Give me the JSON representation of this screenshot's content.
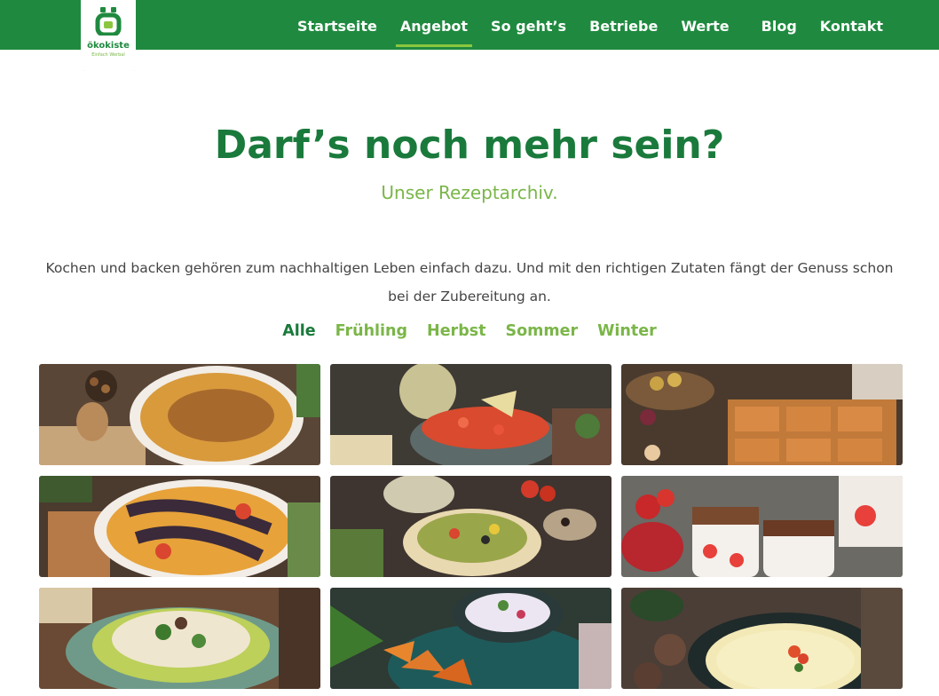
{
  "header": {
    "logo": {
      "brand": "ökokiste",
      "tagline": "Einfach Werbal"
    },
    "nav": [
      {
        "label": "Startseite",
        "active": false
      },
      {
        "label": "Angebot",
        "active": true
      },
      {
        "label": "So geht’s",
        "active": false
      },
      {
        "label": "Betriebe",
        "active": false
      },
      {
        "label": "Werte",
        "active": false
      },
      {
        "label": "Blog",
        "active": false
      },
      {
        "label": "Kontakt",
        "active": false
      }
    ]
  },
  "main": {
    "title": "Darf’s noch mehr sein?",
    "subtitle": "Unser Rezeptarchiv.",
    "intro": "Kochen und backen gehören zum nachhaltigen Leben einfach dazu. Und mit den richtigen Zutaten fängt der Genuss schon bei der Zubereitung an.",
    "filters": [
      {
        "label": "Alle",
        "active": true
      },
      {
        "label": "Frühling",
        "active": false
      },
      {
        "label": "Herbst",
        "active": false
      },
      {
        "label": "Sommer",
        "active": false
      },
      {
        "label": "Winter",
        "active": false
      }
    ]
  },
  "colors": {
    "header_green": "#1f8a3f",
    "title_green": "#1a7a3c",
    "accent_light_green": "#7ab648",
    "text_gray": "#444444"
  },
  "recipes": [
    {
      "name": "nut-gratin-image"
    },
    {
      "name": "tomato-salad-bowl-image"
    },
    {
      "name": "sheet-cake-squares-image"
    },
    {
      "name": "eggplant-tart-image"
    },
    {
      "name": "vegetable-salad-bowl-image"
    },
    {
      "name": "strawberry-dessert-jars-image"
    },
    {
      "name": "pasta-salad-plate-image"
    },
    {
      "name": "potato-wedges-dip-image"
    },
    {
      "name": "cream-soup-image"
    }
  ]
}
